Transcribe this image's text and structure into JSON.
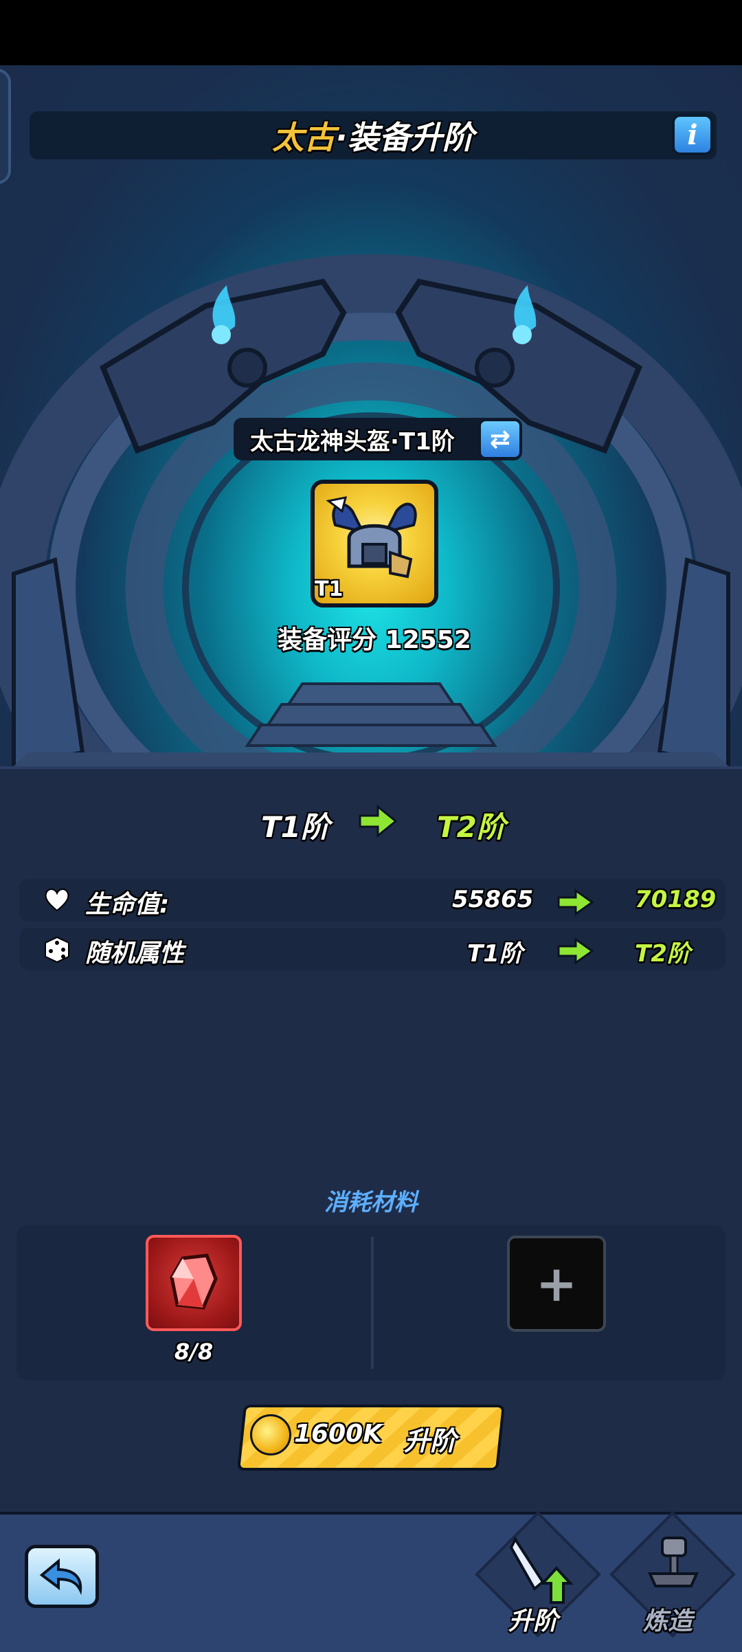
{
  "header": {
    "title_highlight": "太古",
    "title_rest": "·装备升阶",
    "info_label": "i"
  },
  "item": {
    "name": "太古龙神头盔·T1阶",
    "tier_badge": "T1",
    "gear_score_label": "装备评分 12552"
  },
  "upgrade": {
    "from_tier": "T1阶",
    "to_tier": "T2阶"
  },
  "stats": [
    {
      "icon": "heart-icon",
      "label": "生命值:",
      "from": "55865",
      "to": "70189"
    },
    {
      "icon": "dice-icon",
      "label": "随机属性",
      "from": "T1阶",
      "to": "T2阶"
    }
  ],
  "materials": {
    "title": "消耗材料",
    "slot1_icon": "red-gem-icon",
    "slot1_count": "8/8",
    "slot2_label": "+"
  },
  "action": {
    "cost": "1600K",
    "label": "升阶"
  },
  "nav": {
    "upgrade_label": "升阶",
    "forge_label": "炼造"
  },
  "colors": {
    "accent_green": "#c4f542",
    "title_gold": "#f3c23a",
    "button_yellow": "#f6c12c",
    "materials_title_blue": "#5dafff"
  }
}
